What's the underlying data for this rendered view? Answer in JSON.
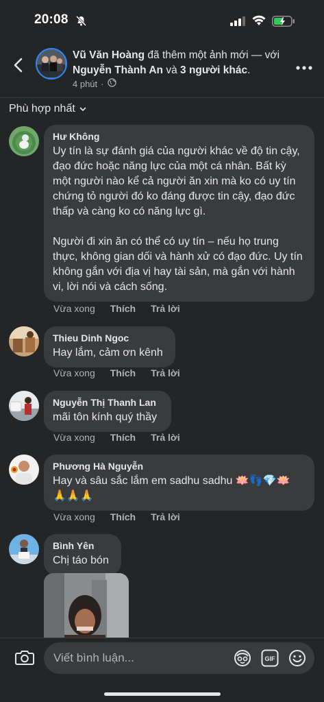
{
  "status": {
    "time": "20:08"
  },
  "post": {
    "author": "Vũ Văn Hoàng",
    "action": "đã thêm một ảnh mới —",
    "with_prefix": "với",
    "tagged": "Nguyễn Thành An",
    "and_word": "và",
    "others": "3 người khác",
    "others_suffix": ".",
    "time": "4 phút",
    "dot": "·"
  },
  "sort": {
    "label": "Phù hợp nhất"
  },
  "comments": [
    {
      "name": "Hư Không",
      "text": "Uy tín là sự đánh giá của người khác về độ tin cậy, đạo đức hoặc năng lực của một cá nhân. Bất kỳ một người nào kể cả người ăn xin mà ko có uy tín chứng tỏ người đó ko đáng được tin cậy, đạo đức thấp và càng ko có năng lực gì.\n\nNgười đi xin ăn có thể có uy tín – nếu họ trung thực, không gian dối và hành xử có đạo đức. Uy tín không gắn với địa vị hay tài sản, mà gắn với hành vi, lời nói và cách sống.",
      "time": "Vừa xong",
      "like": "Thích",
      "reply": "Trả lời"
    },
    {
      "name": "Thieu Dinh Ngoc",
      "text": "Hay lắm, cảm ơn kênh",
      "time": "Vừa xong",
      "like": "Thích",
      "reply": "Trả lời"
    },
    {
      "name": "Nguyễn Thị Thanh Lan",
      "text": "mãi tôn kính quý thầy",
      "time": "Vừa xong",
      "like": "Thích",
      "reply": "Trả lời"
    },
    {
      "name": "Phương Hà Nguyễn",
      "text": "Hay và sâu sắc lắm em sadhu sadhu 🪷👣💎🪷\n🙏🙏🙏",
      "time": "Vừa xong",
      "like": "Thích",
      "reply": "Trả lời"
    },
    {
      "name": "Bình Yên",
      "text": "Chị táo bón"
    }
  ],
  "composer": {
    "placeholder": "Viết bình luận..."
  },
  "icons": [
    "bell-slash-icon",
    "signal-icon",
    "wifi-icon",
    "battery-charging-icon",
    "back-icon",
    "more-icon",
    "chevron-down-icon",
    "globe-icon",
    "camera-icon",
    "avatar-sticker-icon",
    "gif-icon",
    "emoji-icon"
  ],
  "colors": {
    "background": "#242526",
    "bubble": "#3a3b3c",
    "text": "#e4e6eb",
    "secondary": "#b0b3b8",
    "accent": "#2d88ff",
    "battery": "#34c759"
  }
}
